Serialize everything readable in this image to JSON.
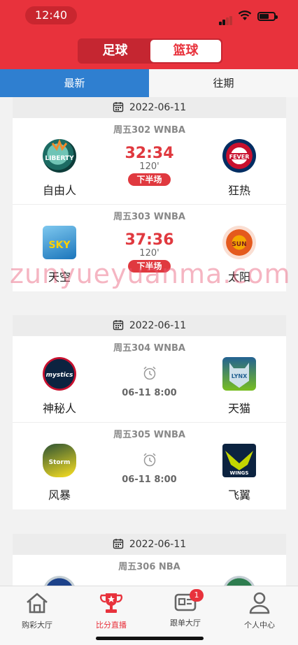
{
  "status_bar": {
    "time": "12:40"
  },
  "sport_tabs": {
    "football": "足球",
    "basketball": "篮球",
    "active": "basketball"
  },
  "sub_tabs": {
    "latest": "最新",
    "past": "往期",
    "active": "latest"
  },
  "groups": [
    {
      "date": "2022-06-11",
      "matches": [
        {
          "league": "周五302 WNBA",
          "home": "自由人",
          "home_icon": "liberty-logo",
          "away": "狂热",
          "away_icon": "fever-logo",
          "score": "32:34",
          "minute": "120'",
          "status": "下半场"
        },
        {
          "league": "周五303 WNBA",
          "home": "天空",
          "home_icon": "sky-logo",
          "away": "太阳",
          "away_icon": "sun-logo",
          "score": "37:36",
          "minute": "120'",
          "status": "下半场"
        }
      ]
    },
    {
      "date": "2022-06-11",
      "matches": [
        {
          "league": "周五304 WNBA",
          "home": "神秘人",
          "home_icon": "mystics-logo",
          "away": "天猫",
          "away_icon": "lynx-logo",
          "start_time": "06-11 8:00"
        },
        {
          "league": "周五305 WNBA",
          "home": "风暴",
          "home_icon": "storm-logo",
          "away": "飞翼",
          "away_icon": "wings-logo",
          "start_time": "06-11 8:00"
        }
      ]
    },
    {
      "date": "2022-06-11",
      "matches": [
        {
          "league": "周五306 NBA"
        }
      ]
    }
  ],
  "watermark": "zunyueyuanma.com",
  "tabbar": {
    "items": [
      {
        "label": "购彩大厅",
        "icon": "home-icon"
      },
      {
        "label": "比分直播",
        "icon": "trophy-icon"
      },
      {
        "label": "跟单大厅",
        "icon": "ticket-icon",
        "badge": "1"
      },
      {
        "label": "个人中心",
        "icon": "user-icon"
      }
    ],
    "active": 1
  },
  "colors": {
    "brand_red": "#e8323c",
    "tab_blue": "#2f7fd0",
    "score_red": "#e0393f"
  }
}
